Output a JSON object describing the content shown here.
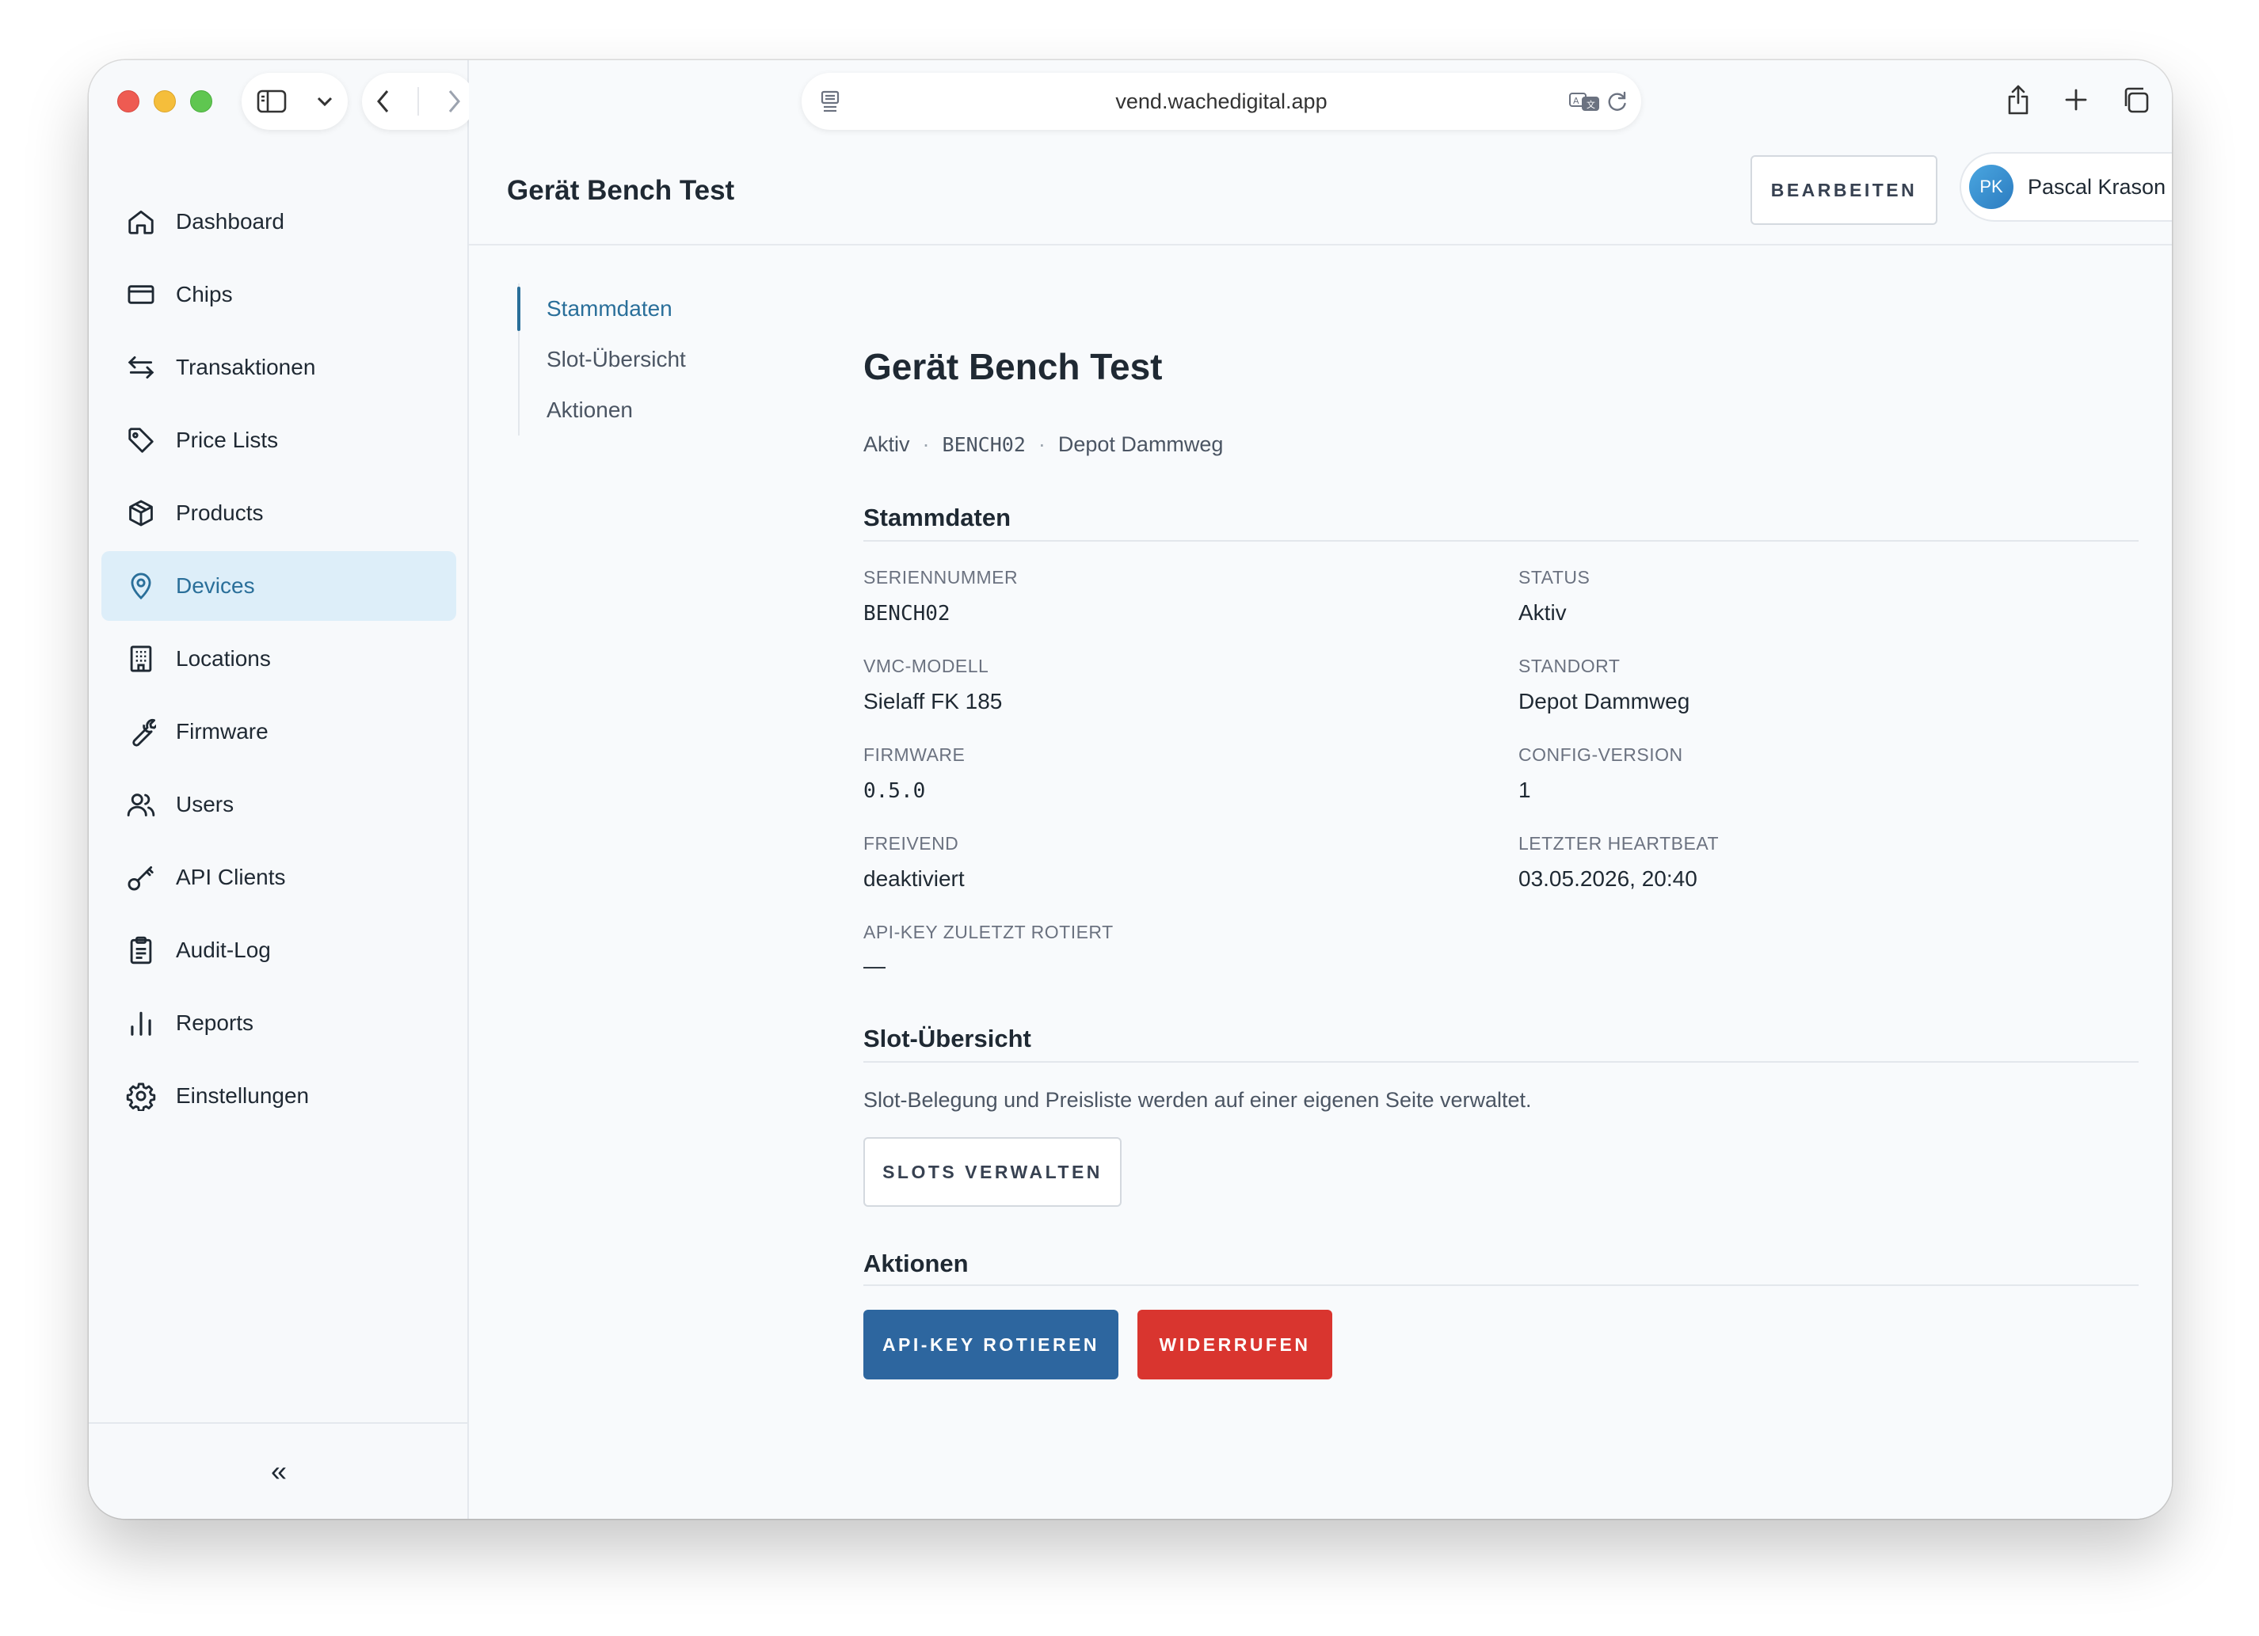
{
  "browser": {
    "url": "vend.wachedigital.app"
  },
  "sidebar": {
    "items": [
      {
        "label": "Dashboard",
        "icon": "home-icon"
      },
      {
        "label": "Chips",
        "icon": "card-icon"
      },
      {
        "label": "Transaktionen",
        "icon": "transfer-arrows-icon"
      },
      {
        "label": "Price Lists",
        "icon": "tag-icon"
      },
      {
        "label": "Products",
        "icon": "box-icon"
      },
      {
        "label": "Devices",
        "icon": "location-pin-icon",
        "active": true
      },
      {
        "label": "Locations",
        "icon": "building-icon"
      },
      {
        "label": "Firmware",
        "icon": "wrench-icon"
      },
      {
        "label": "Users",
        "icon": "users-icon"
      },
      {
        "label": "API Clients",
        "icon": "key-icon"
      },
      {
        "label": "Audit-Log",
        "icon": "clipboard-icon"
      },
      {
        "label": "Reports",
        "icon": "bar-chart-icon"
      },
      {
        "label": "Einstellungen",
        "icon": "gear-icon"
      }
    ],
    "collapse_label": "«"
  },
  "header": {
    "title": "Gerät Bench Test",
    "edit_label": "BEARBEITEN",
    "user": {
      "initials": "PK",
      "name": "Pascal Krason"
    }
  },
  "subnav": {
    "items": [
      {
        "label": "Stammdaten",
        "active": true
      },
      {
        "label": "Slot-Übersicht"
      },
      {
        "label": "Aktionen"
      }
    ]
  },
  "device": {
    "title": "Gerät Bench Test",
    "status": "Aktiv",
    "serial": "BENCH02",
    "location": "Depot Dammweg",
    "separator": "·"
  },
  "stammdaten": {
    "heading": "Stammdaten",
    "fields": [
      {
        "label": "SERIENNUMMER",
        "value": "BENCH02"
      },
      {
        "label": "STATUS",
        "value": "Aktiv"
      },
      {
        "label": "VMC-MODELL",
        "value": "Sielaff FK 185"
      },
      {
        "label": "STANDORT",
        "value": "Depot Dammweg"
      },
      {
        "label": "FIRMWARE",
        "value": "0.5.0"
      },
      {
        "label": "CONFIG-VERSION",
        "value": "1"
      },
      {
        "label": "FREIVEND",
        "value": "deaktiviert"
      },
      {
        "label": "LETZTER HEARTBEAT",
        "value": "03.05.2026, 20:40"
      },
      {
        "label": "API-KEY ZULETZT ROTIERT",
        "value": "—"
      }
    ]
  },
  "slots": {
    "heading": "Slot-Übersicht",
    "description": "Slot-Belegung und Preisliste werden auf einer eigenen Seite verwaltet.",
    "button_label": "SLOTS VERWALTEN"
  },
  "actions": {
    "heading": "Aktionen",
    "rotate_label": "API-KEY ROTIEREN",
    "revoke_label": "WIDERRUFEN"
  },
  "colors": {
    "primary": "#2d669f",
    "danger": "#d9352f",
    "active_bg": "#ddeef9",
    "active_text": "#2a6f9a"
  }
}
